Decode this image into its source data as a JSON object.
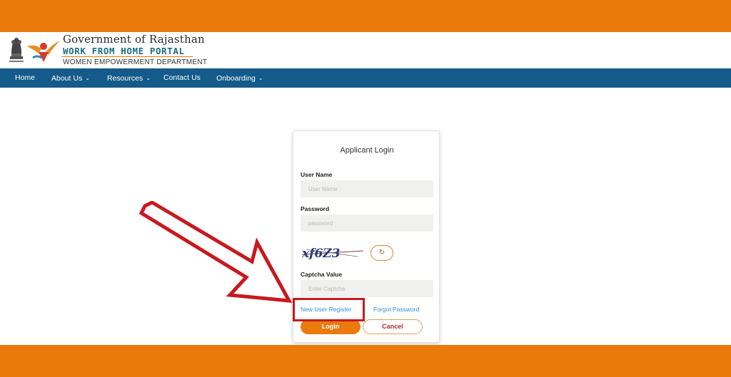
{
  "header": {
    "gov_title": "Government of Rajasthan",
    "portal_title": "WORK FROM HOME PORTAL",
    "dept_title": "WOMEN EMPOWERMENT DEPARTMENT",
    "emblem_icon": "state-emblem-icon",
    "logo_icon": "wfh-portal-logo-icon"
  },
  "nav": {
    "items": [
      {
        "label": "Home",
        "has_dropdown": false
      },
      {
        "label": "About Us",
        "has_dropdown": true
      },
      {
        "label": "Resources",
        "has_dropdown": true
      },
      {
        "label": "Contact Us",
        "has_dropdown": false
      },
      {
        "label": "Onboarding",
        "has_dropdown": true
      }
    ],
    "chevron": "⌄"
  },
  "login": {
    "title": "Applicant Login",
    "username_label": "User Name",
    "username_placeholder": "User Name",
    "password_label": "Password",
    "password_placeholder": "password",
    "captcha_text": "xf6Z3",
    "refresh_icon": "↻",
    "captcha_label": "Captcha Value",
    "captcha_placeholder": "Enter Captcha",
    "new_user_link": "New User Register",
    "forgot_link": "Forgot Password",
    "login_button": "Login",
    "cancel_button": "Cancel"
  },
  "colors": {
    "brand_orange": "#ea7a0c",
    "nav_blue": "#145a8a",
    "portal_teal": "#1c6f84",
    "annotation_red": "#c8191e",
    "link_blue": "#2f8fd6"
  }
}
